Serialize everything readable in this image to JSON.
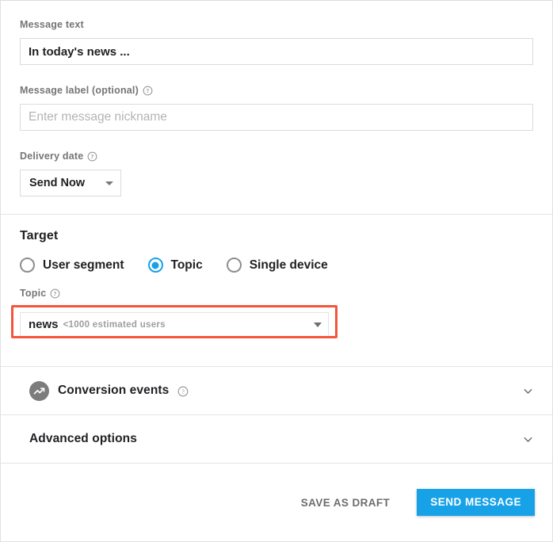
{
  "accent": {
    "blue": "#17a2e8",
    "radio_blue": "#18a0e8",
    "highlight_red": "#f4553c",
    "icon_gray": "#7c7c7c"
  },
  "message": {
    "text_label": "Message text",
    "text_value": "In today's news ...",
    "nickname_label": "Message label (optional)",
    "nickname_help_icon": "help-circle-icon",
    "nickname_placeholder": "Enter message nickname",
    "delivery_label": "Delivery date",
    "delivery_help_icon": "help-circle-icon",
    "delivery_value": "Send Now",
    "delivery_caret_icon": "caret-down-icon"
  },
  "target": {
    "title": "Target",
    "options": [
      {
        "label": "User segment",
        "selected": false
      },
      {
        "label": "Topic",
        "selected": true
      },
      {
        "label": "Single device",
        "selected": false
      }
    ],
    "topic_label": "Topic",
    "topic_help_icon": "help-circle-icon",
    "topic_value": "news",
    "topic_estimate": "<1000 estimated users",
    "topic_caret_icon": "caret-down-icon"
  },
  "accordions": [
    {
      "title": "Conversion events",
      "leading_icon": "analytics-trending-up-icon",
      "help_icon": "help-circle-icon",
      "chevron_icon": "chevron-down-icon"
    },
    {
      "title": "Advanced options",
      "leading_icon": "",
      "help_icon": "",
      "chevron_icon": "chevron-down-icon"
    }
  ],
  "footer": {
    "save_draft_label": "SAVE AS DRAFT",
    "send_label": "SEND MESSAGE"
  }
}
